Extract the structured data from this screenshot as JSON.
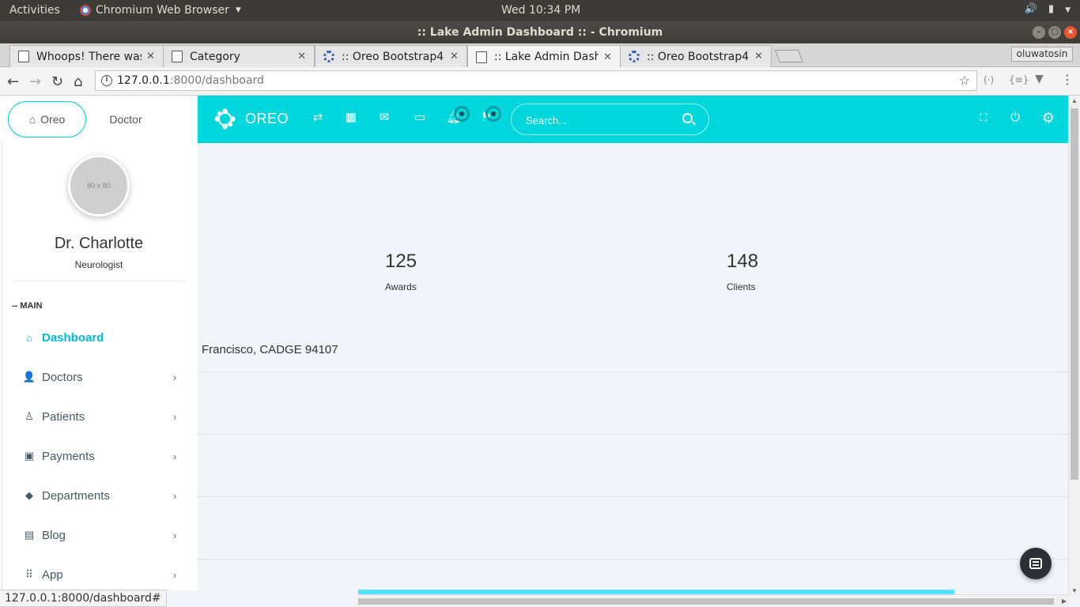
{
  "os": {
    "activities": "Activities",
    "app_name": "Chromium Web Browser",
    "clock": "Wed 10:34 PM"
  },
  "window": {
    "title": ":: Lake Admin Dashboard :: - Chromium"
  },
  "tabs": [
    {
      "title": "Whoops! There was",
      "icon": "document-icon",
      "active": false
    },
    {
      "title": "Category",
      "icon": "document-icon",
      "active": false
    },
    {
      "title": ":: Oreo Bootstrap4",
      "icon": "oreo-favicon",
      "active": false
    },
    {
      "title": ":: Lake Admin Dashb",
      "icon": "document-icon",
      "active": true
    },
    {
      "title": ":: Oreo Bootstrap4",
      "icon": "oreo-favicon",
      "active": false
    }
  ],
  "profile_name": "oluwatosin",
  "address": {
    "host": "127.0.0.1",
    "rest": ":8000/dashboard"
  },
  "sidebar": {
    "tabs": [
      {
        "label": "Oreo",
        "icon": "home-icon",
        "active": true
      },
      {
        "label": "Doctor",
        "active": false
      }
    ],
    "avatar_placeholder": "80 x 80",
    "profile": {
      "name": "Dr. Charlotte",
      "role": "Neurologist"
    },
    "menu_header": "-- MAIN",
    "items": [
      {
        "label": "Dashboard",
        "icon": "home-icon",
        "active": true
      },
      {
        "label": "Doctors",
        "icon": "add-user-icon",
        "caret": "›"
      },
      {
        "label": "Patients",
        "icon": "user-icon",
        "caret": "›"
      },
      {
        "label": "Payments",
        "icon": "wallet-icon",
        "caret": "›"
      },
      {
        "label": "Departments",
        "icon": "label-icon",
        "caret": "›"
      },
      {
        "label": "Blog",
        "icon": "blog-icon",
        "caret": "›"
      },
      {
        "label": "App",
        "icon": "apps-grid-icon",
        "caret": "›"
      }
    ]
  },
  "navbar": {
    "brand": "OREO",
    "search_placeholder": "Search...",
    "accent_color": "#00d7dc"
  },
  "content": {
    "stats": [
      {
        "value": "125",
        "label": "Awards"
      },
      {
        "value": "148",
        "label": "Clients"
      }
    ],
    "address_line": "Francisco, CADGE 94107"
  },
  "statusbar": {
    "url": "127.0.0.1:8000/dashboard#"
  }
}
